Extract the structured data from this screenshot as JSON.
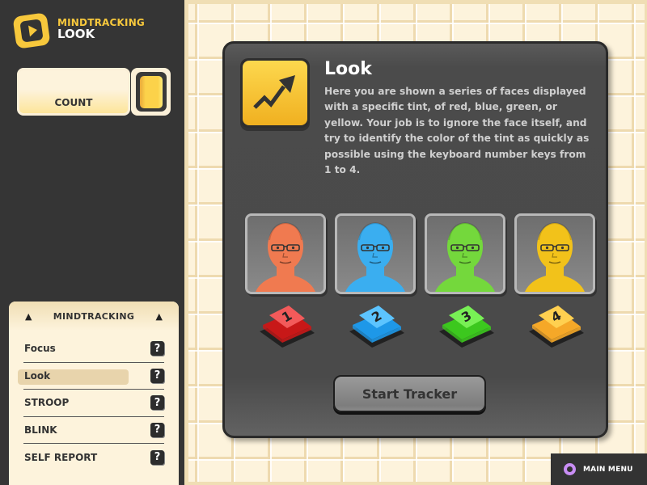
{
  "app": {
    "title": "MINDTRACKING",
    "subtitle": "LOOK",
    "logo_icon": "play-icon"
  },
  "count": {
    "label": "COUNT",
    "indicator_color": "#fcd24a"
  },
  "nav": {
    "header": "MINDTRACKING",
    "arrow_icon": "triangle-up-icon",
    "items": [
      {
        "label": "Focus",
        "active": false
      },
      {
        "label": "Look",
        "active": true
      },
      {
        "label": "STROOP",
        "active": false
      },
      {
        "label": "BLINK",
        "active": false
      },
      {
        "label": "SELF REPORT",
        "active": false
      }
    ],
    "help_glyph": "?"
  },
  "card": {
    "icon": "trend-up-arrow-icon",
    "title": "Look",
    "description": "Here you are shown a series of faces displayed with a specific tint, of red, blue, green, or yellow. Your job is to ignore the face itself, and try to identify the color of the tint as quickly as possible using the keyboard number keys from 1 to 4.",
    "faces": [
      {
        "tint": "red",
        "key": "1",
        "face_color": "#f07a50",
        "key_top": "#f25a5a",
        "key_side": "#c81818"
      },
      {
        "tint": "blue",
        "key": "2",
        "face_color": "#3aaef0",
        "key_top": "#5cc4ff",
        "key_side": "#1e98e8"
      },
      {
        "tint": "green",
        "key": "3",
        "face_color": "#74d83c",
        "key_top": "#78f055",
        "key_side": "#3cc81e"
      },
      {
        "tint": "yellow",
        "key": "4",
        "face_color": "#f2c21a",
        "key_top": "#ffd050",
        "key_side": "#f5a828"
      }
    ],
    "start_button": "Start Tracker"
  },
  "footer": {
    "main_menu": "MAIN MENU",
    "menu_icon": "ring-icon",
    "accent": "#c98ef5"
  },
  "colors": {
    "brand_yellow": "#f7c83c",
    "panel_cream": "#fdf3dc",
    "dark_bg": "#333333"
  }
}
